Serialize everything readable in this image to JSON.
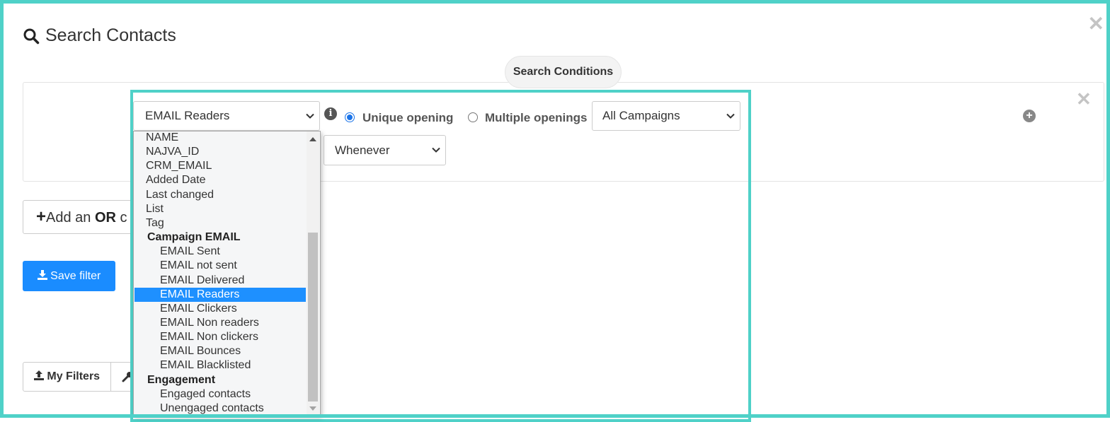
{
  "modal": {
    "title": "Search Contacts"
  },
  "conditions": {
    "badge": "Search Conditions",
    "field_select": {
      "value": "EMAIL Readers",
      "options": [
        {
          "label": "NAME",
          "level": 0
        },
        {
          "label": "NAJVA_ID",
          "level": 0
        },
        {
          "label": "CRM_EMAIL",
          "level": 0
        },
        {
          "label": "Added Date",
          "level": 0
        },
        {
          "label": "Last changed",
          "level": 0
        },
        {
          "label": "List",
          "level": 0
        },
        {
          "label": "Tag",
          "level": 0
        },
        {
          "label": "Campaign EMAIL",
          "level": "group"
        },
        {
          "label": "EMAIL Sent",
          "level": 1
        },
        {
          "label": "EMAIL not sent",
          "level": 1
        },
        {
          "label": "EMAIL Delivered",
          "level": 1
        },
        {
          "label": "EMAIL Readers",
          "level": 1,
          "selected": true
        },
        {
          "label": "EMAIL Clickers",
          "level": 1
        },
        {
          "label": "EMAIL Non readers",
          "level": 1
        },
        {
          "label": "EMAIL Non clickers",
          "level": 1
        },
        {
          "label": "EMAIL Bounces",
          "level": 1
        },
        {
          "label": "EMAIL Blacklisted",
          "level": 1
        },
        {
          "label": "Engagement",
          "level": "group"
        },
        {
          "label": "Engaged contacts",
          "level": 1
        },
        {
          "label": "Unengaged contacts",
          "level": 1
        }
      ]
    },
    "radio_unique": "Unique opening",
    "radio_multiple": "Multiple openings",
    "campaign_select": "All Campaigns",
    "when_select": "Whenever"
  },
  "actions": {
    "add_or_prefix": "Add an ",
    "add_or_bold": "OR",
    "add_or_suffix": " c",
    "save_filter": "Save filter",
    "my_filters": "My Filters"
  },
  "colors": {
    "accent": "#4fd1c8",
    "primary": "#1a8cff",
    "selected_option": "#1e90ff"
  }
}
